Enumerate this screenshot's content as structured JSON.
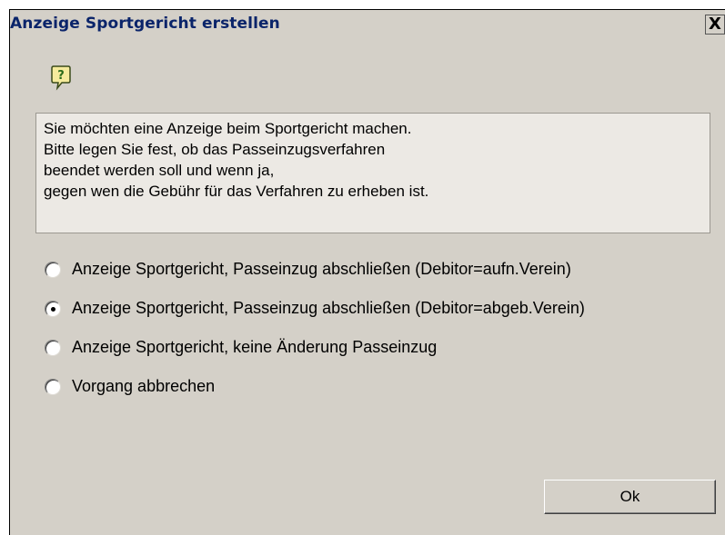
{
  "window": {
    "title": "Anzeige Sportgericht erstellen",
    "close_glyph": "X"
  },
  "icon": {
    "name": "help-question-icon"
  },
  "message": {
    "lines": [
      "Sie möchten eine Anzeige beim Sportgericht machen.",
      "Bitte legen Sie fest, ob das Passeinzugsverfahren",
      "beendet werden soll und wenn ja,",
      "gegen wen die Gebühr für das Verfahren zu erheben ist."
    ]
  },
  "options": [
    {
      "label": "Anzeige Sportgericht, Passeinzug abschließen (Debitor=aufn.Verein)",
      "selected": false
    },
    {
      "label": "Anzeige Sportgericht, Passeinzug abschließen (Debitor=abgeb.Verein)",
      "selected": true
    },
    {
      "label": "Anzeige Sportgericht, keine Änderung Passeinzug",
      "selected": false
    },
    {
      "label": "Vorgang abbrechen",
      "selected": false
    }
  ],
  "buttons": {
    "ok_label": "Ok"
  },
  "colors": {
    "title_text": "#0a246a",
    "dialog_bg": "#d4d0c8",
    "icon_bubble": "#f0e68c"
  }
}
